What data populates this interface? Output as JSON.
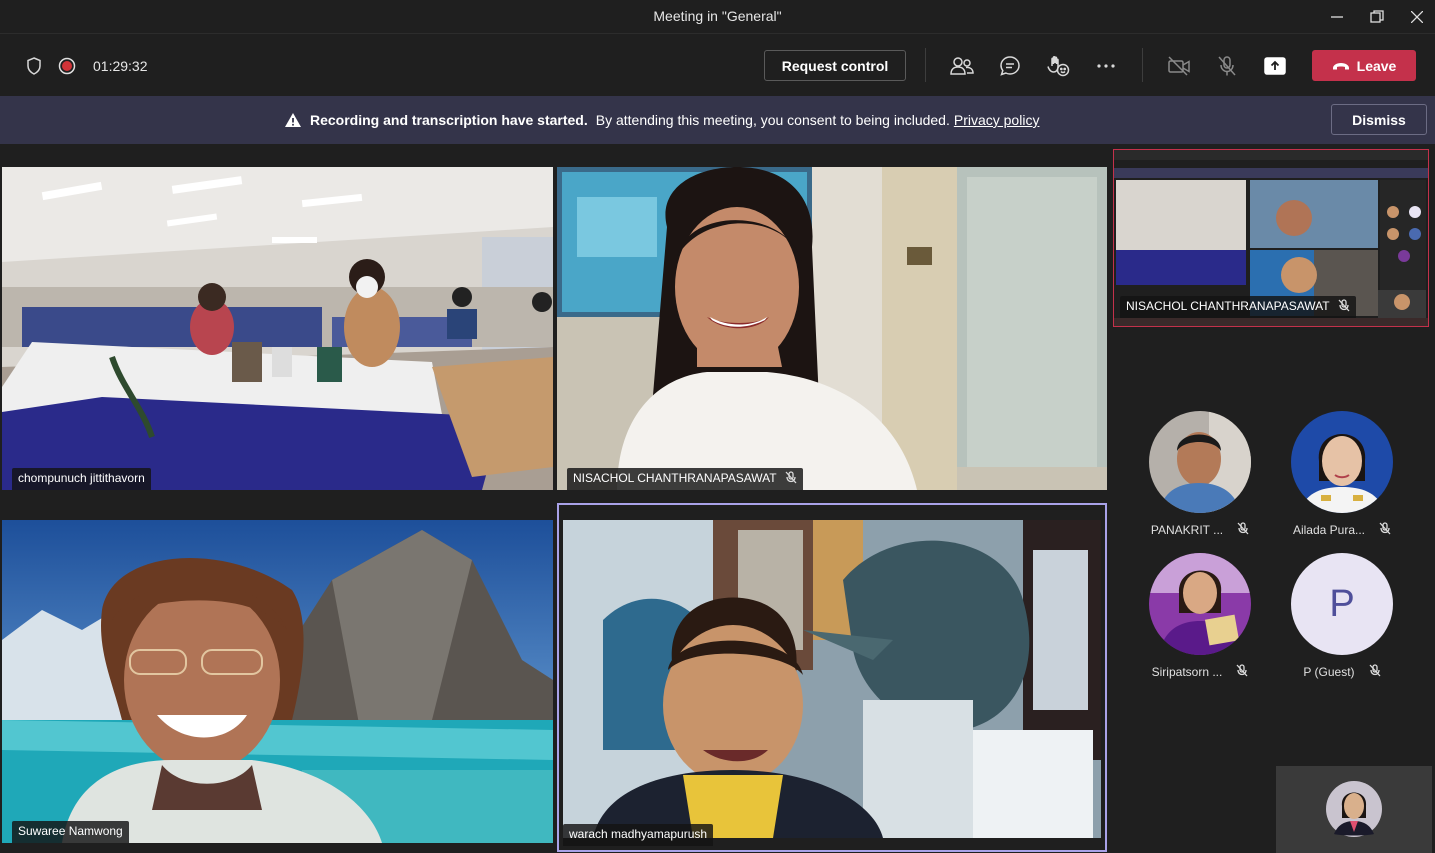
{
  "window": {
    "title": "Meeting in \"General\""
  },
  "toolbar": {
    "timer": "01:29:32",
    "request_control_label": "Request control",
    "leave_label": "Leave"
  },
  "banner": {
    "bold_text": "Recording and transcription have started.",
    "text": "By attending this meeting, you consent to being included.",
    "link_text": "Privacy policy",
    "dismiss_label": "Dismiss"
  },
  "tiles": [
    {
      "name": "chompunuch jittithavorn"
    },
    {
      "name": "NISACHOL CHANTHRANAPASAWAT"
    },
    {
      "name": "Suwaree Namwong"
    },
    {
      "name": "warach madhyamapurush"
    }
  ],
  "screenshare": {
    "name": "NISACHOL CHANTHRANAPASAWAT"
  },
  "participants": [
    {
      "name": "PANAKRIT ..."
    },
    {
      "name": "Ailada Pura..."
    },
    {
      "name": "Siripatsorn ..."
    },
    {
      "name": "P (Guest)",
      "initial": "P"
    }
  ],
  "colors": {
    "leave": "#c4314b",
    "banner": "#34344a",
    "active_speaker_border": "#a9a2e8",
    "guest_avatar": "#e8e4f3"
  }
}
